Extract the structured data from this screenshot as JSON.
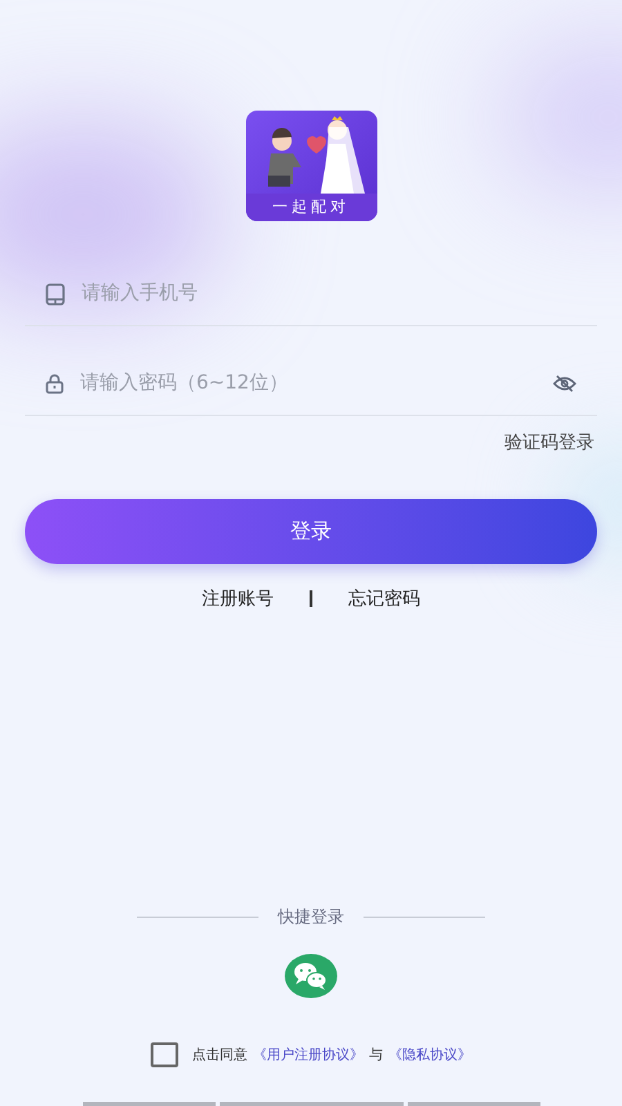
{
  "logo": {
    "caption": "一起配对"
  },
  "fields": [
    {
      "kind": "phone",
      "placeholder": "请输入手机号"
    },
    {
      "kind": "password",
      "placeholder": "请输入密码（6~12位）"
    }
  ],
  "sms_login_link": "验证码登录",
  "login_button": "登录",
  "links": [
    "注册账号",
    "忘记密码"
  ],
  "quick_login": {
    "label": "快捷登录"
  },
  "agreement": {
    "checked": false,
    "prefix": "点击同意",
    "user_agreement": "《用户注册协议》",
    "joiner": "与",
    "privacy_policy": "《隐私协议》"
  }
}
